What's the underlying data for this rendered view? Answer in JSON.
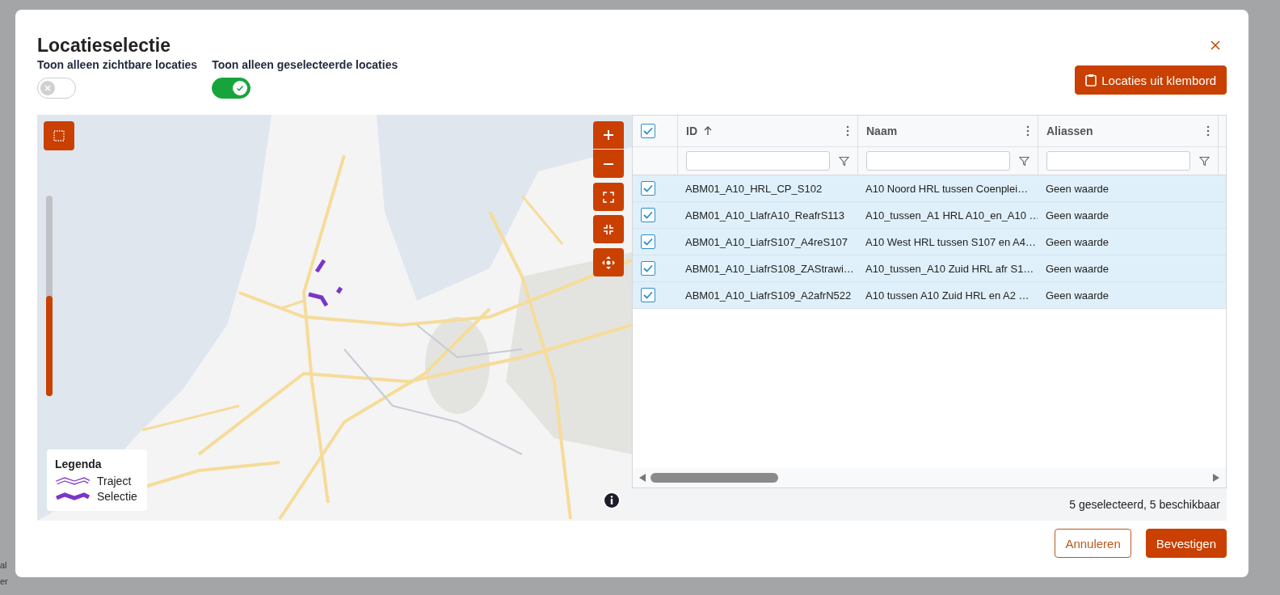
{
  "background_fragments": [
    "al",
    "er"
  ],
  "dialog": {
    "title": "Locatieselectie",
    "toggles": [
      {
        "label": "Toon alleen zichtbare locaties",
        "on": false
      },
      {
        "label": "Toon alleen geselecteerde locaties",
        "on": true
      }
    ],
    "clipboard_button": "Locaties uit klembord",
    "map": {
      "zoom_slider": {
        "level": 0.5
      },
      "legend": {
        "title": "Legenda",
        "items": [
          {
            "label": "Traject",
            "kind": "outline"
          },
          {
            "label": "Selectie",
            "kind": "solid"
          }
        ]
      }
    },
    "table": {
      "select_all": {
        "checked": true
      },
      "columns": [
        {
          "label": "ID",
          "sorted": true
        },
        {
          "label": "Naam",
          "sorted": false
        },
        {
          "label": "Aliassen",
          "sorted": false
        }
      ],
      "rows": [
        {
          "checked": true,
          "cells": [
            "ABM01_A10_HRL_CP_S102",
            "A10 Noord HRL tussen Coenplei…",
            "Geen waarde"
          ]
        },
        {
          "checked": true,
          "cells": [
            "ABM01_A10_LlafrA10_ReafrS113",
            "A10_tussen_A1 HRL A10_en_A10 …",
            "Geen waarde"
          ]
        },
        {
          "checked": true,
          "cells": [
            "ABM01_A10_LiafrS107_A4reS107",
            "A10 West HRL tussen S107 en A4…",
            "Geen waarde"
          ]
        },
        {
          "checked": true,
          "cells": [
            "ABM01_A10_LiafrS108_ZAStrawi…",
            "A10_tussen_A10 Zuid HRL afr S1…",
            "Geen waarde"
          ]
        },
        {
          "checked": true,
          "cells": [
            "ABM01_A10_LiafrS109_A2afrN522",
            "A10 tussen A10 Zuid HRL en A2 …",
            "Geen waarde"
          ]
        }
      ],
      "status": "5 geselecteerd, 5 beschikbaar"
    },
    "buttons": [
      {
        "label": "Annuleren",
        "kind": "secondary"
      },
      {
        "label": "Bevestigen",
        "kind": "primary"
      }
    ]
  }
}
